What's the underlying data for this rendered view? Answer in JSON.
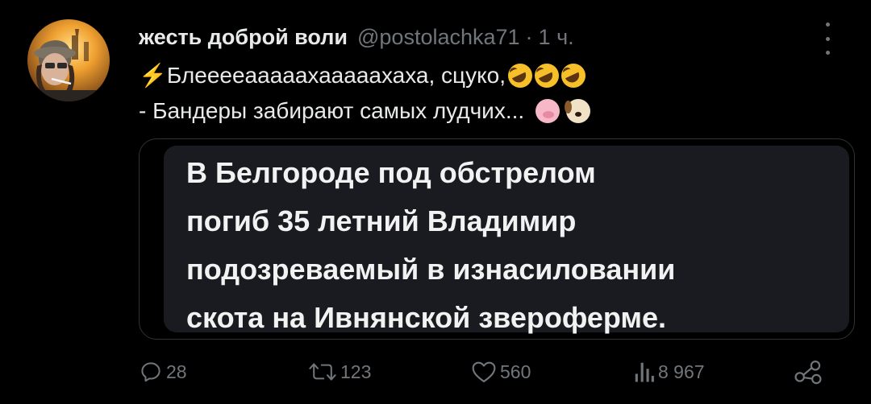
{
  "tweet": {
    "author_name": "жесть доброй воли",
    "handle": "@postolachka71",
    "separator": "·",
    "time": "1 ч.",
    "lines": [
      "⚡Блееееааааахааааахаха, сцуко,",
      "- Бандеры забирают самых лудчих..."
    ],
    "line1_emojis": [
      "rofl-emoji",
      "rofl-emoji",
      "rofl-emoji"
    ],
    "line2_emojis": [
      "pig-emoji",
      "dog-emoji"
    ]
  },
  "media": {
    "lines": [
      "В Белгороде под обстрелом",
      "погиб 35 летний Владимир",
      "подозреваемый в изнасиловании",
      "скота на Ивнянской звероферме."
    ]
  },
  "actions": {
    "replies": "28",
    "reposts": "123",
    "likes": "560",
    "views": "8 967"
  },
  "colors": {
    "background": "#000000",
    "text": "#e7e9ea",
    "muted": "#71767b",
    "bubble": "#1a1b21",
    "lightning": "#f4b400"
  }
}
